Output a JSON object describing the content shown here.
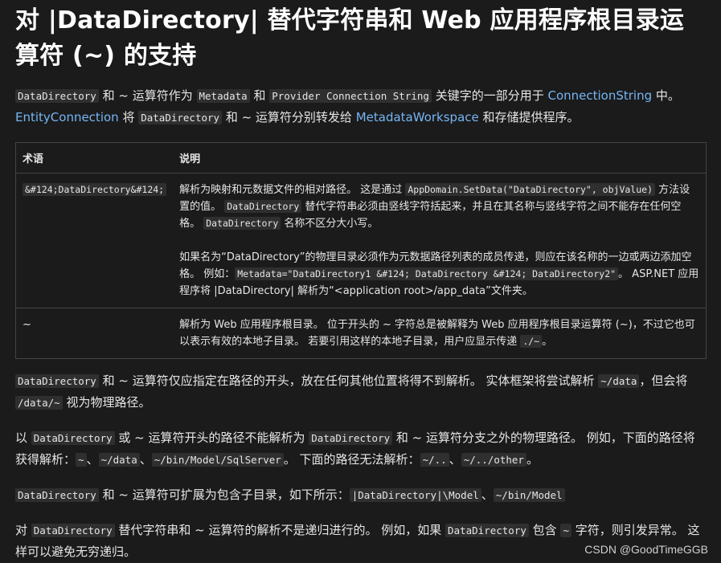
{
  "heading": "对 |DataDirectory| 替代字符串和 Web 应用程序根目录运算符 (~) 的支持",
  "intro": {
    "code_datadirectory": "DataDirectory",
    "t1": " 和 ~ 运算符作为 ",
    "code_metadata": "Metadata",
    "t2": " 和 ",
    "code_provider": "Provider Connection String",
    "t3": " 关键字的一部分用于 ",
    "link_connectionstring": "ConnectionString",
    "t4": " 中。 ",
    "link_entityconnection": "EntityConnection",
    "t5": " 将 ",
    "t6": " 和 ~ 运算符分别转发给 ",
    "link_metadataworkspace": "MetadataWorkspace",
    "t7": " 和存储提供程序。"
  },
  "table": {
    "headers": [
      "术语",
      "说明"
    ],
    "row1": {
      "term": "&#124;DataDirectory&#124;",
      "a1": "解析为映射和元数据文件的相对路径。 这是通过 ",
      "code_setdata": "AppDomain.SetData(\"DataDirectory\", objValue)",
      "a2": " 方法设置的值。 ",
      "code_dd": "DataDirectory",
      "a3": " 替代字符串必须由竖线字符括起来，并且在其名称与竖线字符之间不能存在任何空格。 ",
      "a4": " 名称不区分大小写。",
      "b1": "如果名为“DataDirectory”的物理目录必须作为元数据路径列表的成员传递，则应在该名称的一边或两边添加空格。 例如：",
      "code_example": "Metadata=\"DataDirectory1 &#124; DataDirectory &#124; DataDirectory2\"",
      "b2": "。 ASP.NET 应用程序将 |DataDirectory| 解析为“<application root>/app_data”文件夹。"
    },
    "row2": {
      "term": "~",
      "c1": "解析为 Web 应用程序根目录。 位于开头的 ~ 字符总是被解释为 Web 应用程序根目录运算符 (~)，不过它也可以表示有效的本地子目录。 若要引用这样的本地子目录，用户应显示传递 ",
      "code_local": "./~",
      "c2": "。"
    }
  },
  "para2": {
    "code_dd": "DataDirectory",
    "t1": " 和 ~ 运算符仅应指定在路径的开头，放在任何其他位置将得不到解析。 实体框架将尝试解析 ",
    "code_data1": "~/data",
    "t2": "，但会将 ",
    "code_data2": "/data/~",
    "t3": " 视为物理路径。"
  },
  "para3": {
    "t1": "以 ",
    "code_dd1": "DataDirectory",
    "t2": " 或 ~ 运算符开头的路径不能解析为 ",
    "code_dd2": "DataDirectory",
    "t3": " 和 ~ 运算符分支之外的物理路径。 例如，下面的路径将获得解析：",
    "code_a": "~",
    "sep1": "、",
    "code_b": "~/data",
    "sep2": "、",
    "code_c": "~/bin/Model/SqlServer",
    "t4": "。 下面的路径无法解析：",
    "code_d": "~/..",
    "sep3": "、",
    "code_e": "~/../other",
    "t5": "。"
  },
  "para4": {
    "code_dd": "DataDirectory",
    "t1": " 和 ~ 运算符可扩展为包含子目录，如下所示：",
    "code_a": "|DataDirectory|\\Model",
    "sep": "、",
    "code_b": "~/bin/Model"
  },
  "para5": {
    "t1": "对 ",
    "code_dd1": "DataDirectory",
    "t2": " 替代字符串和 ~ 运算符的解析不是递归进行的。 例如，如果 ",
    "code_dd2": "DataDirectory",
    "t3": " 包含 ",
    "code_tilde": "~",
    "t4": " 字符，则引发异常。 这样可以避免无穷递归。"
  },
  "watermark": "CSDN @GoodTimeGGB"
}
